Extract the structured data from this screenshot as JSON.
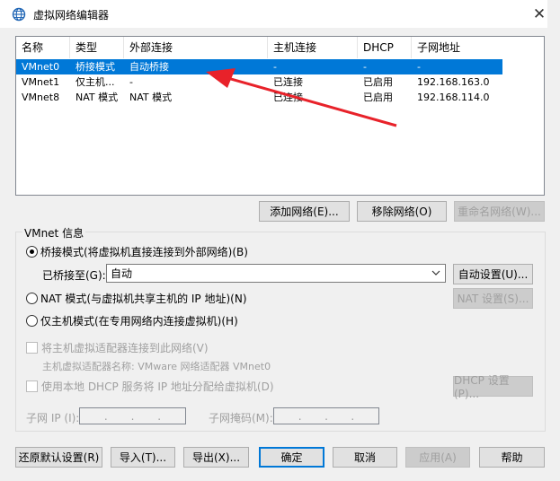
{
  "window": {
    "title": "虚拟网络编辑器",
    "close_glyph": "✕"
  },
  "table": {
    "headers": [
      "名称",
      "类型",
      "外部连接",
      "主机连接",
      "DHCP",
      "子网地址"
    ],
    "rows": [
      {
        "name": "VMnet0",
        "type": "桥接模式",
        "external": "自动桥接",
        "host": "-",
        "dhcp": "-",
        "subnet": "-"
      },
      {
        "name": "VMnet1",
        "type": "仅主机...",
        "external": "-",
        "host": "已连接",
        "dhcp": "已启用",
        "subnet": "192.168.163.0"
      },
      {
        "name": "VMnet8",
        "type": "NAT 模式",
        "external": "NAT 模式",
        "host": "已连接",
        "dhcp": "已启用",
        "subnet": "192.168.114.0"
      }
    ],
    "selected_index": 0
  },
  "table_buttons": {
    "add": "添加网络(E)...",
    "remove": "移除网络(O)",
    "rename": "重命名网络(W)..."
  },
  "vmnet_info": {
    "group_title": "VMnet 信息",
    "bridge_radio": "桥接模式(将虚拟机直接连接到外部网络)(B)",
    "bridged_to_label": "已桥接至(G):",
    "bridged_to_value": "自动",
    "auto_settings": "自动设置(U)...",
    "nat_radio": "NAT 模式(与虚拟机共享主机的 IP 地址)(N)",
    "nat_settings": "NAT 设置(S)...",
    "hostonly_radio": "仅主机模式(在专用网络内连接虚拟机)(H)",
    "connect_adapter_check": "将主机虚拟适配器连接到此网络(V)",
    "adapter_name_label": "主机虚拟适配器名称: VMware 网络适配器 VMnet0",
    "dhcp_check": "使用本地 DHCP 服务将 IP 地址分配给虚拟机(D)",
    "dhcp_settings": "DHCP 设置(P)...",
    "subnet_ip_label": "子网 IP (I):",
    "subnet_mask_label": "子网掩码(M):",
    "ip_dots": ".",
    "selected_mode": "bridge"
  },
  "footer_buttons": {
    "restore": "还原默认设置(R)",
    "import": "导入(T)...",
    "export": "导出(X)...",
    "ok": "确定",
    "cancel": "取消",
    "apply": "应用(A)",
    "help": "帮助"
  },
  "colors": {
    "selection": "#0078d7",
    "annotation_arrow": "#e8222a"
  }
}
